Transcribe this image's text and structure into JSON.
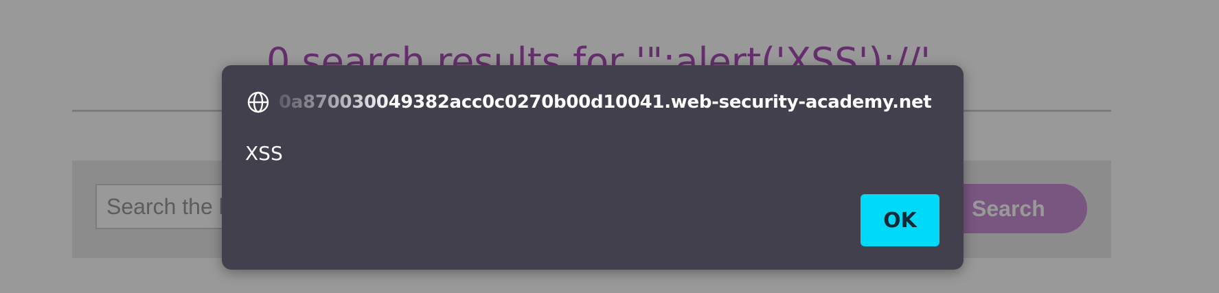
{
  "page": {
    "results_heading": "0 search results for '\";alert('XSS');//'",
    "search": {
      "placeholder": "Search the blog...",
      "button_label": "Search"
    }
  },
  "dialog": {
    "origin": "0a870030049382acc0c0270b00d10041.web-security-academy.net",
    "message": "XSS",
    "ok_label": "OK",
    "origin_icon": "globe-icon"
  },
  "colors": {
    "dialog_background": "#43404d",
    "ok_button": "#00d9f7",
    "accent_purple": "#a94fb6"
  }
}
